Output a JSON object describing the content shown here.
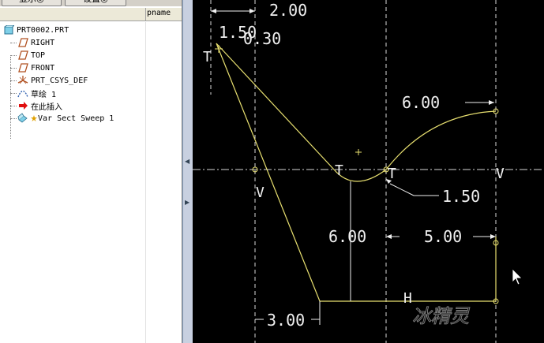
{
  "toolbar": {
    "show_label": "显示◎",
    "settings_label": "设置◎"
  },
  "tree": {
    "header_col": "pname",
    "root": "PRT0002.PRT",
    "items": [
      {
        "label": "RIGHT",
        "icon": "datum-plane-icon"
      },
      {
        "label": "TOP",
        "icon": "datum-plane-icon"
      },
      {
        "label": "FRONT",
        "icon": "datum-plane-icon"
      },
      {
        "label": "PRT_CSYS_DEF",
        "icon": "csys-icon"
      },
      {
        "label": "草绘 1",
        "icon": "sketch-icon"
      },
      {
        "label": "在此插入",
        "icon": "insert-here-arrow-icon"
      },
      {
        "label": "Var Sect Sweep 1",
        "icon": "var-sect-sweep-icon"
      }
    ]
  },
  "sketch": {
    "dimensions": [
      "2.00",
      "1.50",
      "0.30",
      "6.00",
      "1.50",
      "6.00",
      "5.00",
      "3.00"
    ],
    "constraints": [
      "T",
      "T",
      "T",
      "V",
      "V",
      "H"
    ],
    "watermark": "冰精灵",
    "colors": {
      "geometry": "#e8e070",
      "text": "#f0f0f0",
      "background": "#000000",
      "centerline": "#d8d8d8"
    }
  }
}
